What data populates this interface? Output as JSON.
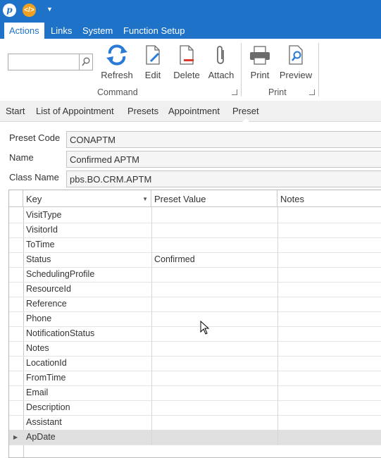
{
  "menu": [
    "Actions",
    "Links",
    "System",
    "Function Setup"
  ],
  "ribbon": {
    "search_value": "",
    "buttons": {
      "refresh": "Refresh",
      "edit": "Edit",
      "delete": "Delete",
      "attach": "Attach",
      "print": "Print",
      "preview": "Preview"
    },
    "groups": {
      "command": "Command",
      "print": "Print"
    }
  },
  "tabs": [
    "Start",
    "List of Appointment",
    "Presets",
    "Appointment",
    "Preset"
  ],
  "form": {
    "preset_code_label": "Preset Code",
    "preset_code": "CONAPTM",
    "name_label": "Name",
    "name": "Confirmed APTM",
    "class_name_label": "Class Name",
    "class_name": "pbs.BO.CRM.APTM"
  },
  "grid": {
    "columns": [
      "Key",
      "Preset Value",
      "Notes"
    ],
    "rows": [
      [
        "VisitType",
        "",
        ""
      ],
      [
        "VisitorId",
        "",
        ""
      ],
      [
        "ToTime",
        "",
        ""
      ],
      [
        "Status",
        "Confirmed",
        ""
      ],
      [
        "SchedulingProfile",
        "",
        ""
      ],
      [
        "ResourceId",
        "",
        ""
      ],
      [
        "Reference",
        "",
        ""
      ],
      [
        "Phone",
        "",
        ""
      ],
      [
        "NotificationStatus",
        "",
        ""
      ],
      [
        "Notes",
        "",
        ""
      ],
      [
        "LocationId",
        "",
        ""
      ],
      [
        "FromTime",
        "",
        ""
      ],
      [
        "Email",
        "",
        ""
      ],
      [
        "Description",
        "",
        ""
      ],
      [
        "Assistant",
        "",
        ""
      ],
      [
        "ApDate",
        "",
        ""
      ]
    ],
    "selected_row": 15
  }
}
